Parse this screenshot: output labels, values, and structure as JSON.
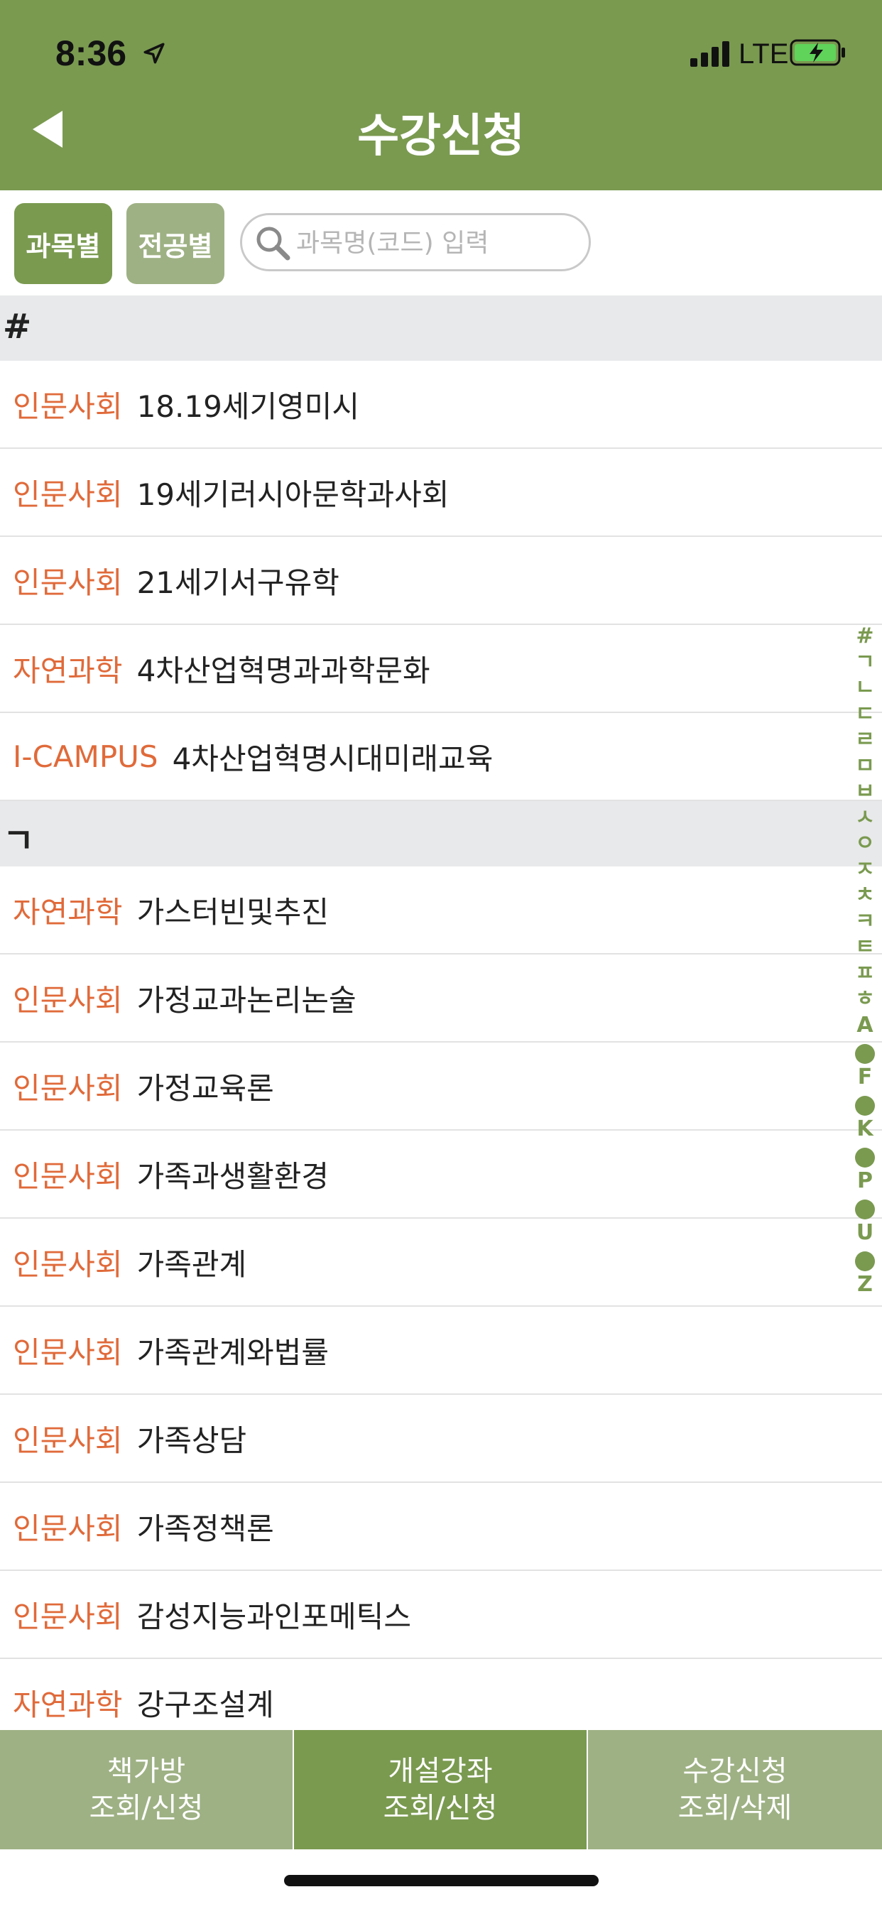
{
  "status_bar": {
    "time": "8:36",
    "network": "LTE"
  },
  "header": {
    "title": "수강신청"
  },
  "filters": {
    "subject_tab": "과목별",
    "major_tab": "전공별",
    "search_placeholder": "과목명(코드) 입력"
  },
  "sections": [
    {
      "header": "#",
      "rows": [
        {
          "category": "인문사회",
          "name": "18.19세기영미시"
        },
        {
          "category": "인문사회",
          "name": "19세기러시아문학과사회"
        },
        {
          "category": "인문사회",
          "name": "21세기서구유학"
        },
        {
          "category": "자연과학",
          "name": "4차산업혁명과과학문화"
        },
        {
          "category": "I-CAMPUS",
          "name": "4차산업혁명시대미래교육"
        }
      ]
    },
    {
      "header": "ㄱ",
      "rows": [
        {
          "category": "자연과학",
          "name": "가스터빈및추진"
        },
        {
          "category": "인문사회",
          "name": "가정교과논리논술"
        },
        {
          "category": "인문사회",
          "name": "가정교육론"
        },
        {
          "category": "인문사회",
          "name": "가족과생활환경"
        },
        {
          "category": "인문사회",
          "name": "가족관계"
        },
        {
          "category": "인문사회",
          "name": "가족관계와법률"
        },
        {
          "category": "인문사회",
          "name": "가족상담"
        },
        {
          "category": "인문사회",
          "name": "가족정책론"
        },
        {
          "category": "인문사회",
          "name": "감성지능과인포메틱스"
        },
        {
          "category": "자연과학",
          "name": "강구조설계"
        }
      ]
    }
  ],
  "index_items": [
    "#",
    "ㄱ",
    "ㄴ",
    "ㄷ",
    "ㄹ",
    "ㅁ",
    "ㅂ",
    "ㅅ",
    "ㅇ",
    "ㅈ",
    "ㅊ",
    "ㅋ",
    "ㅌ",
    "ㅍ",
    "ㅎ",
    "A",
    "•",
    "F",
    "•",
    "K",
    "•",
    "P",
    "•",
    "U",
    "•",
    "Z"
  ],
  "bottom_tabs": [
    {
      "line1": "책가방",
      "line2": "조회/신청"
    },
    {
      "line1": "개설강좌",
      "line2": "조회/신청"
    },
    {
      "line1": "수강신청",
      "line2": "조회/삭제"
    }
  ],
  "colors": {
    "brand_green": "#7a9a50",
    "light_green": "#9eb184",
    "category_orange": "#e06a3a"
  }
}
